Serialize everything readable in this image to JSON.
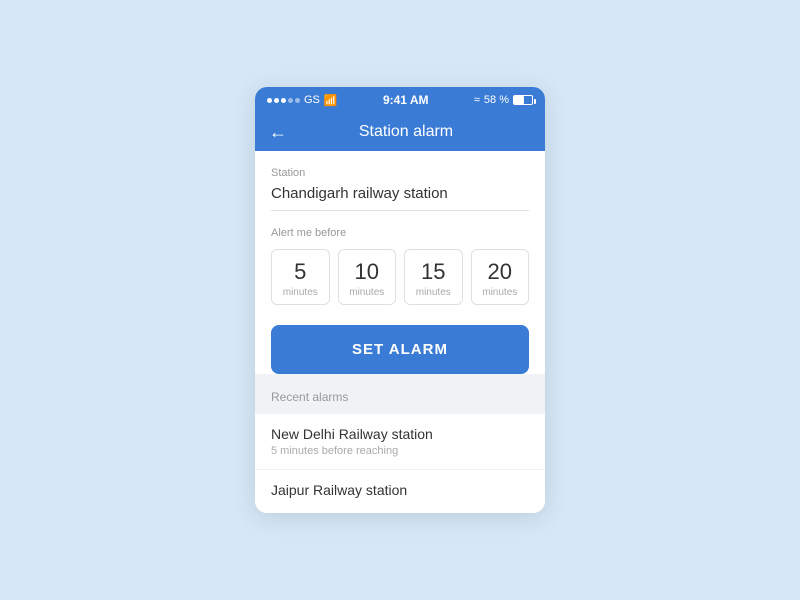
{
  "statusBar": {
    "carrier": "GS",
    "time": "9:41 AM",
    "battery": "58 %",
    "signal": "●●●"
  },
  "navBar": {
    "backLabel": "←",
    "title": "Station alarm"
  },
  "stationField": {
    "label": "Station",
    "value": "Chandigarh railway station"
  },
  "alertSection": {
    "label": "Alert me before",
    "options": [
      {
        "number": "5",
        "unit": "minutes"
      },
      {
        "number": "10",
        "unit": "minutes"
      },
      {
        "number": "15",
        "unit": "minutes"
      },
      {
        "number": "20",
        "unit": "minutes"
      }
    ]
  },
  "setAlarmButton": {
    "label": "SET ALARM"
  },
  "recentSection": {
    "label": "Recent alarms",
    "items": [
      {
        "name": "New Delhi Railway station",
        "sub": "5 minutes before reaching"
      },
      {
        "name": "Jaipur Railway station",
        "sub": ""
      }
    ]
  }
}
